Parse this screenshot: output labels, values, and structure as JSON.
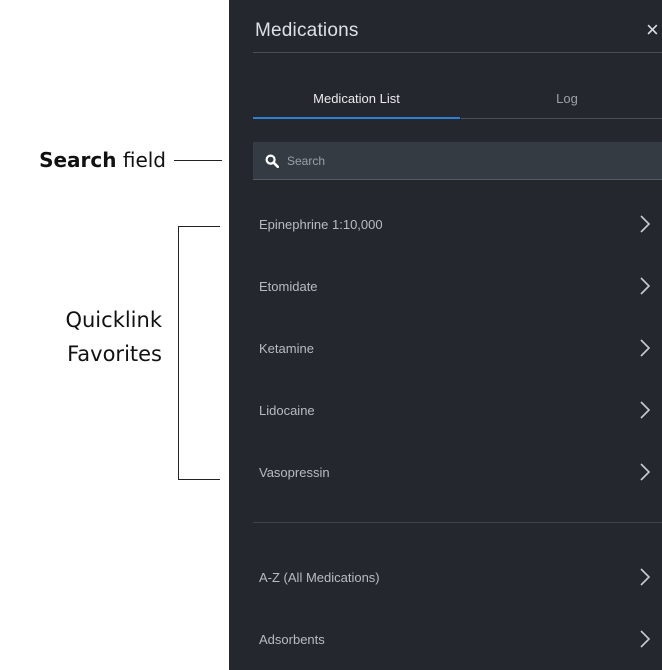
{
  "annotations": {
    "search_bold": "Search",
    "search_rest": " field",
    "quicklink_line1": "Quicklink",
    "quicklink_line2": "Favorites"
  },
  "panel": {
    "title": "Medications",
    "close_glyph": "×",
    "tabs": [
      {
        "label": "Medication List",
        "active": true
      },
      {
        "label": "Log",
        "active": false
      }
    ],
    "search": {
      "placeholder": "Search",
      "value": ""
    },
    "favorites": [
      {
        "label": "Epinephrine 1:10,000"
      },
      {
        "label": "Etomidate"
      },
      {
        "label": "Ketamine"
      },
      {
        "label": "Lidocaine"
      },
      {
        "label": "Vasopressin"
      }
    ],
    "categories": [
      {
        "label": "A-Z (All Medications)"
      },
      {
        "label": "Adsorbents"
      }
    ],
    "icons": {
      "search": "search-icon",
      "chevron": "chevron-right-icon",
      "close": "close-icon"
    }
  },
  "colors": {
    "panel_bg": "#24282e",
    "accent": "#2f7fd0",
    "search_bg": "#353b42"
  }
}
